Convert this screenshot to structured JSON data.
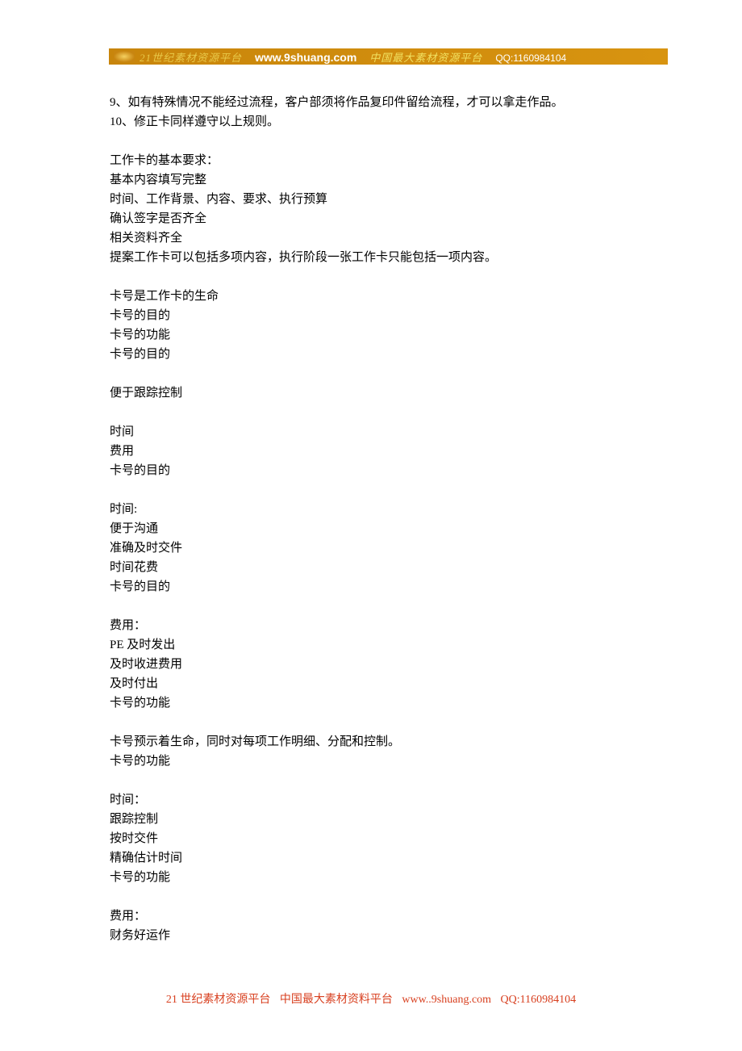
{
  "header": {
    "part1": "21世纪素材资源平台",
    "part2": "www.9shuang.com",
    "part3": "中国最大素材资源平台",
    "part4": "QQ:1160984104"
  },
  "body": {
    "lines": [
      "9、如有特殊情况不能经过流程，客户部须将作品复印件留给流程，才可以拿走作品。",
      "10、修正卡同样遵守以上规则。",
      "",
      "工作卡的基本要求：",
      "基本内容填写完整",
      "时间、工作背景、内容、要求、执行预算",
      "确认签字是否齐全",
      "相关资料齐全",
      "提案工作卡可以包括多项内容，执行阶段一张工作卡只能包括一项内容。",
      "",
      "卡号是工作卡的生命",
      "卡号的目的",
      "卡号的功能",
      "卡号的目的",
      "",
      "便于跟踪控制",
      "",
      "时间",
      "费用",
      "卡号的目的",
      "",
      "时间:",
      "便于沟通",
      "准确及时交件",
      "时间花费",
      "卡号的目的",
      "",
      "费用：",
      "PE 及时发出",
      "及时收进费用",
      "及时付出",
      "卡号的功能",
      "",
      "卡号预示着生命，同时对每项工作明细、分配和控制。",
      "卡号的功能",
      "",
      "时间：",
      "跟踪控制",
      "按时交件",
      "精确估计时间",
      "卡号的功能",
      "",
      "费用：",
      "财务好运作"
    ]
  },
  "footer": {
    "part1": "21 世纪素材资源平台",
    "part2": "中国最大素材资料平台",
    "part3": "www..9shuang.com",
    "part4": "QQ:1160984104"
  }
}
